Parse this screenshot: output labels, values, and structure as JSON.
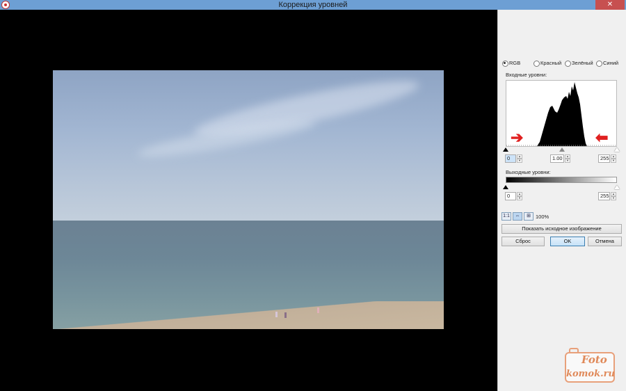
{
  "window": {
    "title": "Коррекция уровней",
    "close_glyph": "✕"
  },
  "channels": {
    "items": [
      {
        "label": "RGB",
        "checked": true
      },
      {
        "label": "Красный",
        "checked": false
      },
      {
        "label": "Зелёный",
        "checked": false
      },
      {
        "label": "Синий",
        "checked": false
      }
    ]
  },
  "input_levels": {
    "label": "Входные уровни:",
    "black": "0",
    "gamma": "1.00",
    "white": "255"
  },
  "output_levels": {
    "label": "Выходные уровни:",
    "black": "0",
    "white": "255"
  },
  "zoom": {
    "buttons": [
      "1:1",
      "⇔",
      "⊞"
    ],
    "value": "100%"
  },
  "buttons": {
    "show_original": "Показать исходное изображение",
    "reset": "Сброс",
    "ok": "OK",
    "cancel": "Отмена"
  },
  "watermark": {
    "line1": "Foto",
    "line2": "komok.ru"
  },
  "colors": {
    "titlebar": "#6d9fd4",
    "close": "#c75050",
    "arrow": "#e02020",
    "watermark": "#e08a5a"
  },
  "icons": {
    "spin_up": "▲",
    "spin_down": "▼",
    "arrow_right": "➔",
    "arrow_left": "⬅"
  }
}
